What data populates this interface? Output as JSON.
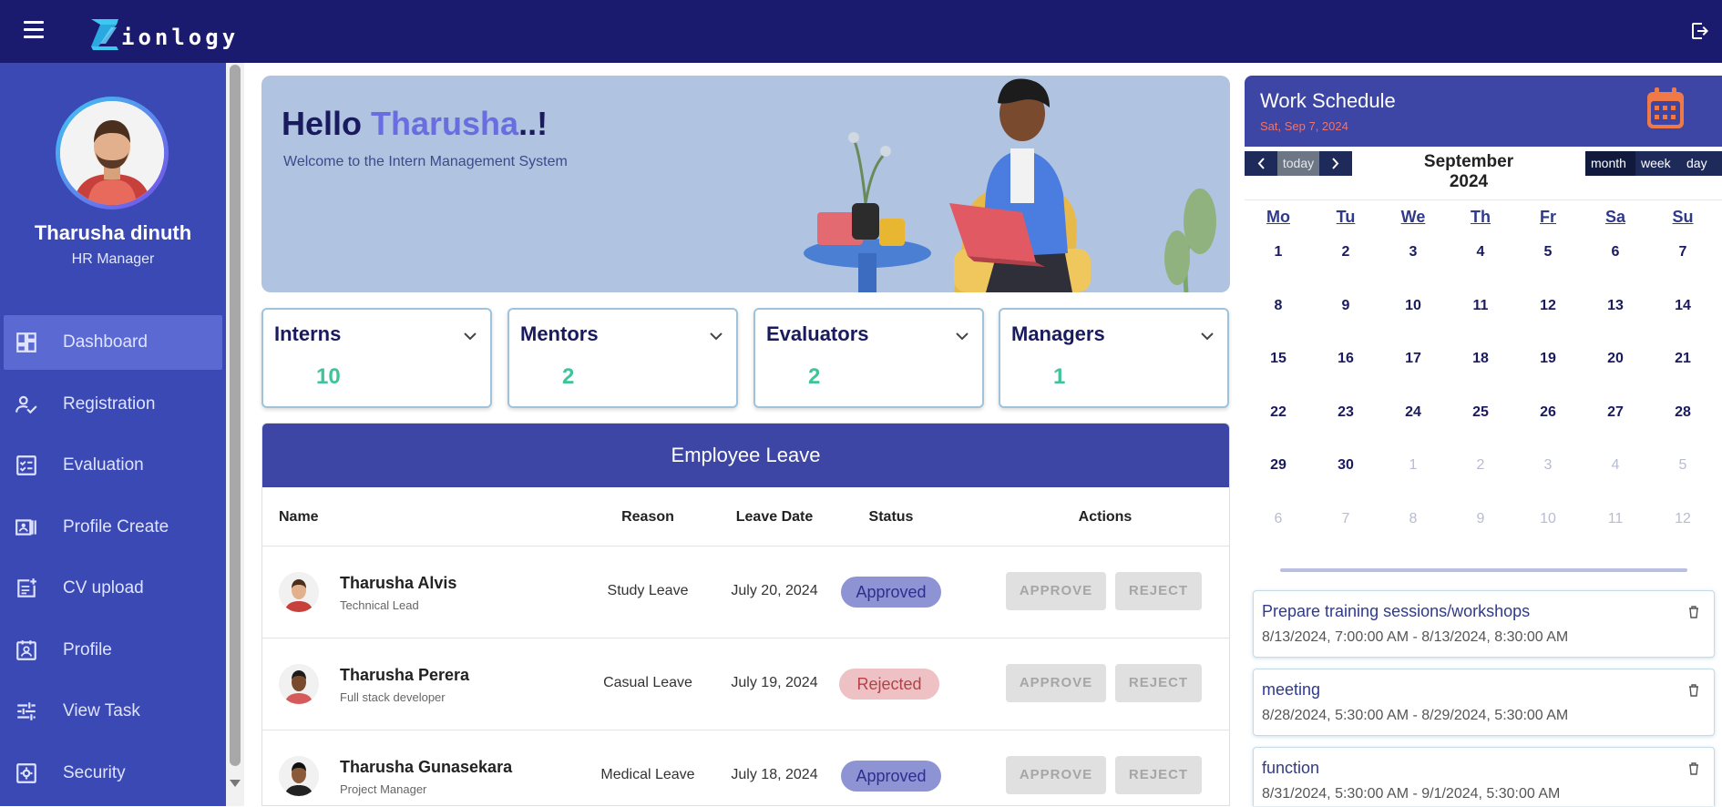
{
  "app": {
    "logo_text": "ionlogy"
  },
  "sidebar": {
    "user_name": "Tharusha dinuth",
    "user_role": "HR Manager",
    "items": [
      {
        "label": "Dashboard",
        "icon": "dashboard-icon",
        "active": true
      },
      {
        "label": "Registration",
        "icon": "person-check-icon"
      },
      {
        "label": "Evaluation",
        "icon": "checklist-icon"
      },
      {
        "label": "Profile Create",
        "icon": "id-card-icon"
      },
      {
        "label": "CV upload",
        "icon": "note-add-icon"
      },
      {
        "label": "Profile",
        "icon": "contact-badge-icon"
      },
      {
        "label": "View Task",
        "icon": "tune-icon"
      },
      {
        "label": "Security",
        "icon": "security-gear-icon"
      }
    ]
  },
  "hero": {
    "greeting": "Hello",
    "name": "Tharusha",
    "suffix": "..!",
    "subtitle": "Welcome to the Intern Management System"
  },
  "stats": [
    {
      "title": "Interns",
      "value": "10"
    },
    {
      "title": "Mentors",
      "value": "2"
    },
    {
      "title": "Evaluators",
      "value": "2"
    },
    {
      "title": "Managers",
      "value": "1"
    }
  ],
  "leave": {
    "title": "Employee Leave",
    "columns": [
      "Name",
      "Reason",
      "Leave Date",
      "Status",
      "Actions"
    ],
    "approve_label": "APPROVE",
    "reject_label": "REJECT",
    "rows": [
      {
        "name": "Tharusha Alvis",
        "role": "Technical Lead",
        "reason": "Study Leave",
        "date": "July 20, 2024",
        "status": "Approved"
      },
      {
        "name": "Tharusha Perera",
        "role": "Full stack developer",
        "reason": "Casual Leave",
        "date": "July 19, 2024",
        "status": "Rejected"
      },
      {
        "name": "Tharusha Gunasekara",
        "role": "Project Manager",
        "reason": "Medical Leave",
        "date": "July 18, 2024",
        "status": "Approved"
      }
    ]
  },
  "schedule": {
    "title": "Work Schedule",
    "date": "Sat, Sep 7, 2024",
    "today_label": "today",
    "month_title": "September 2024",
    "views": [
      "month",
      "week",
      "day"
    ],
    "weekdays": [
      "Mo",
      "Tu",
      "We",
      "Th",
      "Fr",
      "Sa",
      "Su"
    ],
    "weeks": [
      [
        [
          "1",
          0
        ],
        [
          "2",
          0
        ],
        [
          "3",
          0
        ],
        [
          "4",
          0
        ],
        [
          "5",
          0
        ],
        [
          "6",
          0
        ],
        [
          "7",
          0
        ]
      ],
      [
        [
          "8",
          0
        ],
        [
          "9",
          0
        ],
        [
          "10",
          0
        ],
        [
          "11",
          0
        ],
        [
          "12",
          0
        ],
        [
          "13",
          0
        ],
        [
          "14",
          0
        ]
      ],
      [
        [
          "15",
          0
        ],
        [
          "16",
          0
        ],
        [
          "17",
          0
        ],
        [
          "18",
          0
        ],
        [
          "19",
          0
        ],
        [
          "20",
          0
        ],
        [
          "21",
          0
        ]
      ],
      [
        [
          "22",
          0
        ],
        [
          "23",
          0
        ],
        [
          "24",
          0
        ],
        [
          "25",
          0
        ],
        [
          "26",
          0
        ],
        [
          "27",
          0
        ],
        [
          "28",
          0
        ]
      ],
      [
        [
          "29",
          0
        ],
        [
          "30",
          0
        ],
        [
          "1",
          1
        ],
        [
          "2",
          1
        ],
        [
          "3",
          1
        ],
        [
          "4",
          1
        ],
        [
          "5",
          1
        ]
      ],
      [
        [
          "6",
          1
        ],
        [
          "7",
          1
        ],
        [
          "8",
          1
        ],
        [
          "9",
          1
        ],
        [
          "10",
          1
        ],
        [
          "11",
          1
        ],
        [
          "12",
          1
        ]
      ]
    ],
    "events": [
      {
        "title": "Prepare training sessions/workshops",
        "time": "8/13/2024, 7:00:00 AM - 8/13/2024, 8:30:00 AM"
      },
      {
        "title": "meeting",
        "time": "8/28/2024, 5:30:00 AM - 8/29/2024, 5:30:00 AM"
      },
      {
        "title": "function",
        "time": "8/31/2024, 5:30:00 AM - 9/1/2024, 5:30:00 AM"
      }
    ]
  },
  "colors": {
    "topbar": "#1a1a6e",
    "sidebar": "#3a49b4",
    "accent": "#3d46a4",
    "stat_value": "#3fc39a",
    "approved_badge": "#8d93d3",
    "rejected_badge": "#eec1c4"
  }
}
